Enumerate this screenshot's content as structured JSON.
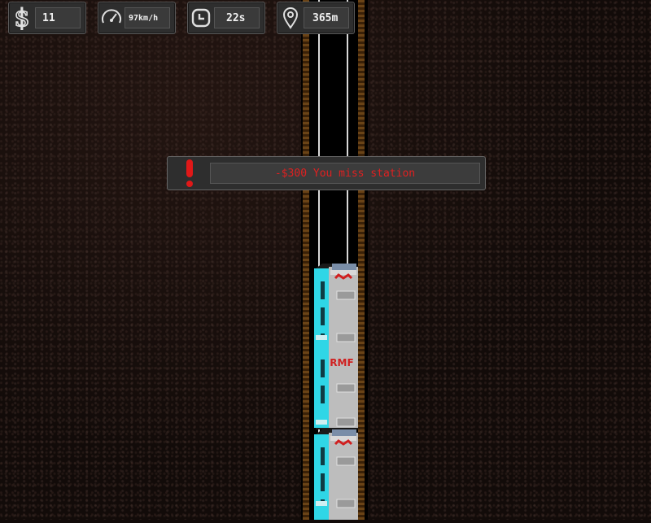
{
  "hud": {
    "money": {
      "icon": "dollar-icon",
      "value": "11"
    },
    "speed": {
      "icon": "speedometer-icon",
      "value": "97km/h"
    },
    "time": {
      "icon": "clock-icon",
      "value": "22s"
    },
    "distance": {
      "icon": "location-pin-icon",
      "value": "365m"
    }
  },
  "alert": {
    "icon": "exclamation-icon",
    "message": "-$300 You miss station",
    "color": "#e02020"
  },
  "train": {
    "body_color": "#2fd6e6",
    "roof_color": "#c8c8c8",
    "logo_color": "#d02020"
  }
}
